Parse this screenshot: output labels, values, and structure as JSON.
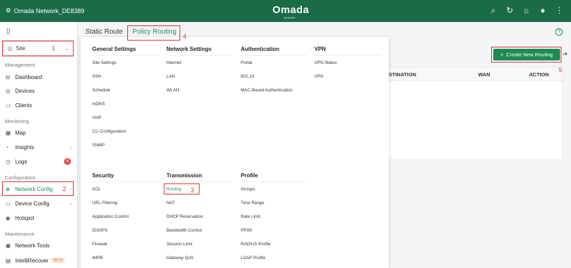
{
  "topbar": {
    "network_name": "Omada Network_DE8389",
    "brand": "Omada",
    "brand_sub": "by tp-link"
  },
  "sidebar": {
    "site_label": "Site",
    "sections": {
      "management": "Management",
      "monitoring": "Monitoring",
      "configuration": "Configuration",
      "maintenance": "Maintenance"
    },
    "items": {
      "dashboard": "Dashboard",
      "devices": "Devices",
      "clients": "Clients",
      "map": "Map",
      "insights": "Insights",
      "logs": "Logs",
      "logs_badge": "6",
      "network_config": "Network Config",
      "device_config": "Device Config",
      "hotspot": "Hotspot",
      "network_tools": "Network Tools",
      "intellirecover": "IntelliRecover",
      "beta": "BETA"
    }
  },
  "annotations": {
    "n1": "1",
    "n2": "2",
    "n3": "3",
    "n4": "4",
    "n5": "5"
  },
  "tabs": {
    "static_route": "Static Route",
    "policy_routing": "Policy Routing"
  },
  "toolbar": {
    "create_label": "Create New Routing"
  },
  "table": {
    "headers": {
      "destination": "STINATION",
      "wan": "WAN",
      "action": "ACTION"
    }
  },
  "menu": {
    "general": {
      "title": "General Settings",
      "items": [
        "Site Settings",
        "SSH",
        "Schedule",
        "mDNS",
        "VoIP",
        "CLI Configuration",
        "SNMP"
      ]
    },
    "network": {
      "title": "Network Settings",
      "items": [
        "Internet",
        "LAN",
        "WLAN"
      ]
    },
    "authentication": {
      "title": "Authentication",
      "items": [
        "Portal",
        "802.1X",
        "MAC-Based Authentication"
      ]
    },
    "vpn": {
      "title": "VPN",
      "items": [
        "VPN Status",
        "VPN"
      ]
    },
    "security": {
      "title": "Security",
      "items": [
        "ACL",
        "URL Filtering",
        "Application Control",
        "IDS/IPS",
        "Firewall",
        "IMPB"
      ]
    },
    "transmission": {
      "title": "Transmission",
      "items": [
        "Routing",
        "NAT",
        "DHCP Reservation",
        "Bandwidth Control",
        "Session Limit",
        "Gateway QoS"
      ]
    },
    "profile": {
      "title": "Profile",
      "items": [
        "Groups",
        "Time Range",
        "Rate Limit",
        "PPSK",
        "RADIUS Profile",
        "LDAP Profile"
      ]
    }
  },
  "colors": {
    "brand_green": "#1a6b47",
    "accent_green": "#1f8a52",
    "annotation_red": "#e03030"
  }
}
